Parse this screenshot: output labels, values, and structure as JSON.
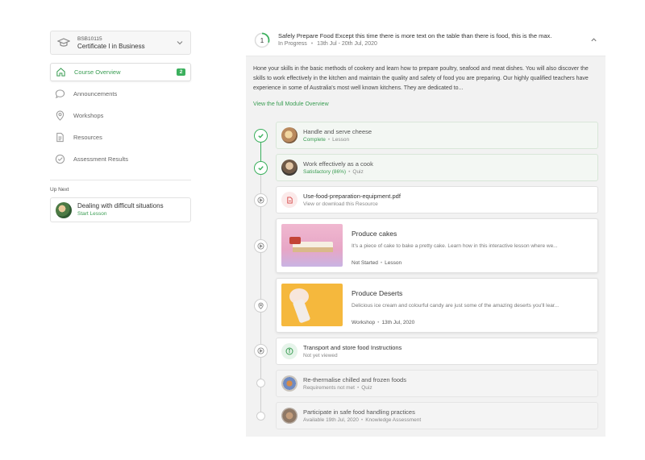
{
  "sidebar": {
    "course_code": "BSB10115",
    "course_name": "Certificate I in Business",
    "nav": [
      {
        "label": "Course Overview",
        "icon": "home-icon",
        "badge": "2",
        "active": true
      },
      {
        "label": "Announcements",
        "icon": "speech-bubble-icon"
      },
      {
        "label": "Workshops",
        "icon": "location-pin-icon"
      },
      {
        "label": "Resources",
        "icon": "document-icon"
      },
      {
        "label": "Assessment Results",
        "icon": "check-circle-icon"
      }
    ],
    "up_next_label": "Up Next",
    "up_next": {
      "title": "Dealing with difficult situations",
      "action": "Start Lesson"
    }
  },
  "module": {
    "number": "1",
    "progress": 0.3,
    "title": "Safely Prepare Food Except this time there is more text on the table than there is food, this is the max.",
    "status": "In Progress",
    "dates": "13th Jul - 20th Jul, 2020",
    "description": "Hone your skills in the basic methods of cookery and learn how to prepare poultry, seafood and meat dishes. You will also discover the skills to work effectively in the kitchen and maintain the quality and safety of food you are preparing. Our highly qualified teachers have experience in some of Australia's most well known kitchens. They are dedicated to...",
    "overview_link": "View the full Module Overview"
  },
  "items": [
    {
      "title": "Handle and serve cheese",
      "status": "Complete",
      "type": "Lesson"
    },
    {
      "title": "Work effectively as a cook",
      "status": "Satisfactory (86%)",
      "type": "Quiz"
    },
    {
      "title": "Use-food-preparation-equipment.pdf",
      "subtitle": "View or download this Resource"
    },
    {
      "title": "Produce cakes",
      "description": "It's a piece of cake to bake a pretty cake. Learn how in this interactive lesson where we...",
      "status": "Not Started",
      "type": "Lesson"
    },
    {
      "title": "Produce Deserts",
      "description": "Delicious ice cream and colourful candy are just some of the amazing deserts you'll lear...",
      "status": "Workshop",
      "type": "13th Jul, 2020"
    },
    {
      "title": "Transport and store food Instructions",
      "subtitle": "Not yet viewed"
    },
    {
      "title": "Re-thermalise chilled and frozen foods",
      "status": "Requirements not met",
      "type": "Quiz"
    },
    {
      "title": "Participate in safe food handling practices",
      "status": "Available 19th Jul, 2020",
      "type": "Knowledge Assessment"
    }
  ],
  "colors": {
    "accent": "#3bb05d",
    "panel": "#f2f2f2"
  }
}
